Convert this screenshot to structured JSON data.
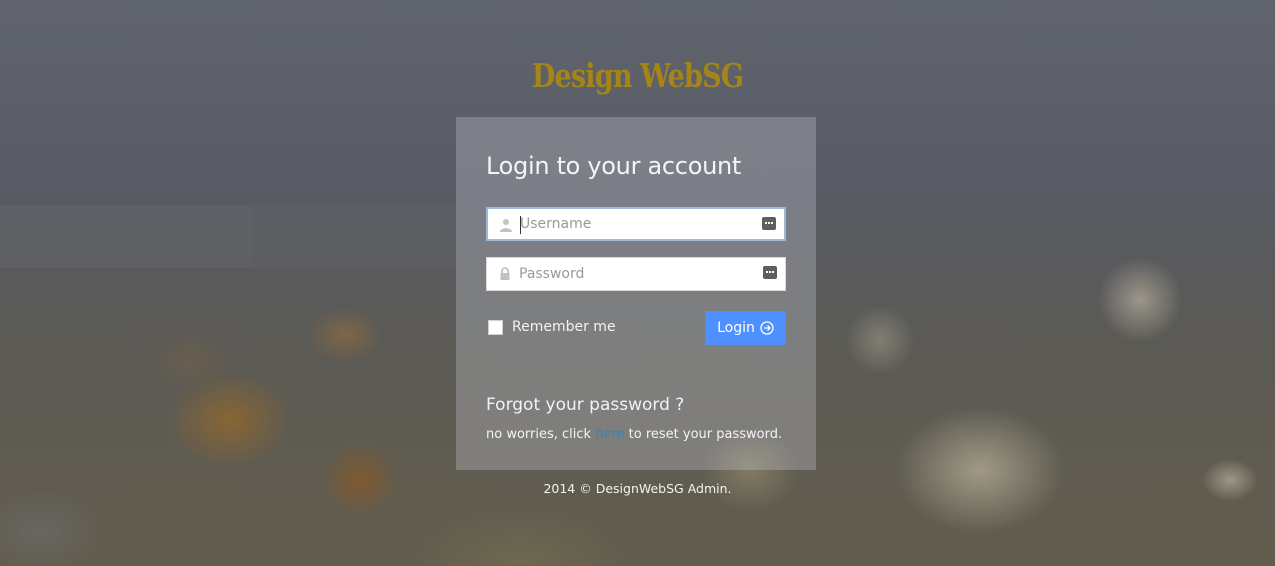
{
  "brand": {
    "logo_text": "Design WebSG",
    "logo_color": "#a58418"
  },
  "login": {
    "title": "Login to your account",
    "username_placeholder": "Username",
    "username_value": "",
    "password_placeholder": "Password",
    "password_value": "",
    "remember_label": "Remember me",
    "remember_checked": false,
    "button_label": "Login",
    "button_color": "#4d90fe"
  },
  "forgot": {
    "title": "Forgot your password ?",
    "text_before": "no worries, click",
    "link_text": "here",
    "text_after": "to reset your password.",
    "link_color": "#2e86c9"
  },
  "footer": {
    "copyright": "2014 © DesignWebSG Admin."
  },
  "icons": {
    "username": "user-icon",
    "password": "lock-icon",
    "keyboard": "keyboard-icon",
    "login": "arrow-circle-right-icon"
  }
}
